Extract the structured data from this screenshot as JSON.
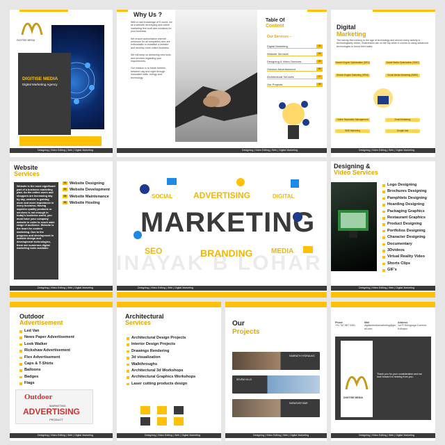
{
  "brand": {
    "name": "DIGITISE MEDIA",
    "tagline": "Digital Marketing Agency",
    "footer": "Designing | Video Editing | Web | Digital Marketing",
    "accent": "#ffc107",
    "dark": "#3a3a3a"
  },
  "cover": {
    "title": "DIGITISE MEDIA",
    "subtitle": "Digital Marketing Agency"
  },
  "why_us": {
    "title": "Why Us ?",
    "points": [
      "With a vast knowledge of E-world, we as a website developing and online marketing firm craft rare solutions for your business.",
      "We ensure authoritative internet presence for all companies who are enthusiastic to establish a website and develop more online business.",
      "We will keep on delivering new tools and services regarding your requirements.",
      "Our mission is to break barriers between day and night through innovative skills, energy and technology."
    ]
  },
  "toc": {
    "title_line1": "Table Of",
    "title_line2": "Content",
    "section": "Our Services –",
    "items": [
      {
        "label": "Digital Marketing",
        "num": "03"
      },
      {
        "label": "Website Services",
        "num": "04"
      },
      {
        "label": "Designing & Video Services",
        "num": "05"
      },
      {
        "label": "Outdoor Advertisement",
        "num": "06"
      },
      {
        "label": "Architectural Services",
        "num": "07"
      },
      {
        "label": "Our Projects",
        "num": "08"
      }
    ]
  },
  "digital": {
    "title_line1": "Digital",
    "title_line2": "Marketing",
    "intro": "The twenty-first century is the age of technology and almost every activity is technologically driven. Businesses are on the top when it comes to using advanced technologies to boost their sales.",
    "chips": [
      "Search Engine Optimization (SEO)",
      "Social Media Optimization (SMO)",
      "Search Engine Marketing (SEM)",
      "Social Media Marketing (SMM)",
      "Online Reputation Management",
      "Email Marketing",
      "SMS Marketing",
      "Google Ads"
    ]
  },
  "website": {
    "title_line1": "Website",
    "title_line2": "Services",
    "body": "Website is the most significant part of a business marketing plan. As the online users and shoppers are increasing day by day, website is gaining more and more importance in every business. Having superior quality products or services is not enough in today's business world, you must have your company website in order to reach wide range of audience. Website is the heart for content marketing. Due to the progress and development in website design and development technologies, there are numerous digital marketing tools available.",
    "items": [
      {
        "n": "01",
        "label": "Website Designing"
      },
      {
        "n": "02",
        "label": "Website Development"
      },
      {
        "n": "03",
        "label": "Website Maintenance"
      },
      {
        "n": "04",
        "label": "Website Hosting"
      }
    ]
  },
  "center": {
    "words": [
      "SOCIAL",
      "ADVERTISING",
      "DIGITAL",
      "MARKETING",
      "SEO",
      "BRANDING",
      "MEDIA"
    ],
    "watermark": "VINAYAK B LOHAR"
  },
  "designing": {
    "title_line1": "Designing &",
    "title_line2": "Video Services",
    "items": [
      "Logo Designing",
      "Brochures Designing",
      "Pamphlets Designing",
      "Hoarding Designing",
      "Packaging Graphics",
      "Restaurant Graphics",
      "Product Designing",
      "Portfolios Designing",
      "Character Designing",
      "Documentary",
      "3Dvideos",
      "Virtual Reality Video",
      "Shorts Clips",
      "GIF's"
    ]
  },
  "outdoor": {
    "title_line1": "Outdoor",
    "title_line2": "Advertisement",
    "items": [
      "Led Van",
      "News Paper Advertisement",
      "Look Walker",
      "Rickshaw Advertisement",
      "Flex Advertisement",
      "Caps & T-Shirts",
      "Balloons",
      "Badges",
      "Flags"
    ],
    "image_words": [
      "Outdoor",
      "ADVERTISING",
      "MARKETING",
      "PRODUCT"
    ]
  },
  "architectural": {
    "title_line1": "Architectural",
    "title_line2": "Services",
    "items": [
      "Architectural Design Projects",
      "Interior Design Projects",
      "Drawings Rendering",
      "3d visualization",
      "Walkthroughs",
      "Architectural 3d Workshops",
      "Architectural Graphics Workshops",
      "Laser cutting products design"
    ]
  },
  "projects": {
    "title_line1": "Our",
    "title_line2": "Projects",
    "cards": [
      "SAMRATH HYDRAULIC",
      "SEVEN HILLS",
      "SARASVATI BAR"
    ]
  },
  "contact": {
    "phone_label": "Phone",
    "mail_label": "Mail",
    "address_label": "Address",
    "phone": "+91 787 867 9381",
    "mail": "digitisemediamarketing@gmail.com",
    "address": "1st Fl Shivganga Commer, Kolhapur",
    "closing": "Thank you for your consideration and we look forward to hearing from you."
  }
}
